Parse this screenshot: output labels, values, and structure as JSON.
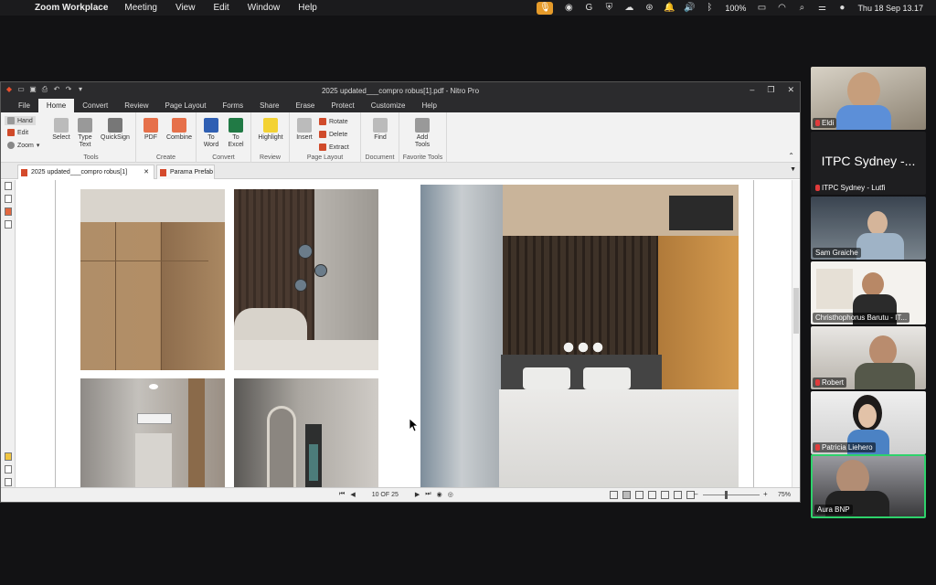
{
  "menubar": {
    "app_name": "Zoom Workplace",
    "items": [
      "Meeting",
      "View",
      "Edit",
      "Window",
      "Help"
    ],
    "battery": "100%",
    "datetime": "Thu 18 Sep  13.17"
  },
  "nitro": {
    "window_title": "2025 updated___compro robus[1].pdf - Nitro Pro",
    "tabs": [
      "File",
      "Home",
      "Convert",
      "Review",
      "Page Layout",
      "Forms",
      "Share",
      "Erase",
      "Protect",
      "Customize",
      "Help"
    ],
    "active_tab": "Home",
    "tools": {
      "hand": "Hand",
      "edit": "Edit",
      "zoom": "Zoom"
    },
    "groups": {
      "tools": {
        "label": "Tools",
        "select": "Select",
        "type_text": "Type\nText",
        "quicksign": "QuickSign"
      },
      "create": {
        "label": "Create",
        "pdf": "PDF",
        "combine": "Combine"
      },
      "convert": {
        "label": "Convert",
        "to_word": "To\nWord",
        "to_excel": "To\nExcel"
      },
      "review": {
        "label": "Review",
        "highlight": "Highlight"
      },
      "page_layout": {
        "label": "Page Layout",
        "insert": "Insert",
        "rotate": "Rotate",
        "delete": "Delete",
        "extract": "Extract"
      },
      "document": {
        "label": "Document",
        "find": "Find"
      },
      "favorite": {
        "label": "Favorite Tools",
        "add_tools": "Add\nTools"
      }
    },
    "doc_tabs": [
      "2025 updated___compro robus[1]",
      "Parama Prefab"
    ],
    "page_indicator": "10 OF 25",
    "zoom_level": "75%"
  },
  "participants": [
    {
      "name": "Eldi",
      "muted": true,
      "video": true
    },
    {
      "name": "ITPC Sydney - Lutfi",
      "muted": true,
      "video": false,
      "display": "ITPC Sydney -..."
    },
    {
      "name": "Sam Graiche",
      "muted": false,
      "video": true
    },
    {
      "name": "Christhophorus Barutu - IT...",
      "muted": false,
      "video": true
    },
    {
      "name": "Robert",
      "muted": true,
      "video": true
    },
    {
      "name": "Patricia Liehero",
      "muted": true,
      "video": true
    },
    {
      "name": "Aura BNP",
      "muted": false,
      "video": true,
      "selected": true
    }
  ]
}
